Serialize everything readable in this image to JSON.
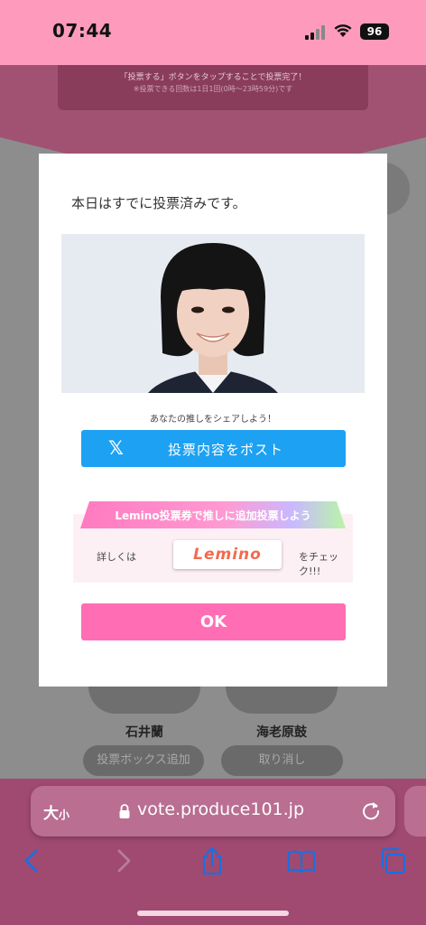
{
  "status_bar": {
    "time": "07:44",
    "battery": "96"
  },
  "background": {
    "banner_line1": "「投票する」ボタンをタップすることで投票完了！",
    "banner_line2": "※投票できる回数は1日1回(0時〜23時59分)です",
    "trainees": [
      {
        "name": "石井蘭",
        "button": "投票ボックス追加"
      },
      {
        "name": "海老原鼓",
        "button": "取り消し"
      }
    ]
  },
  "modal": {
    "title": "本日はすでに投票済みです。",
    "share_label": "あなたの推しをシェアしよう！",
    "post_button": {
      "icon": "x-logo-icon",
      "glyph": "𝕏",
      "label": "投票内容をポスト"
    },
    "lemino": {
      "ribbon": "Lemino投票券で推しに追加投票しよう",
      "prefix": "詳しくは",
      "logo_text": "Lemino",
      "suffix": "をチェック!!!"
    },
    "ok_button": "OK"
  },
  "browser": {
    "text_size_big": "大",
    "text_size_small": "小",
    "url": "vote.produce101.jp"
  },
  "colors": {
    "status_bar": "#fe9bbd",
    "x_blue": "#1da1f2",
    "ok_pink": "#ff6eb4",
    "browser_bar": "#a04a71",
    "ios_blue": "#1a6fe0"
  }
}
